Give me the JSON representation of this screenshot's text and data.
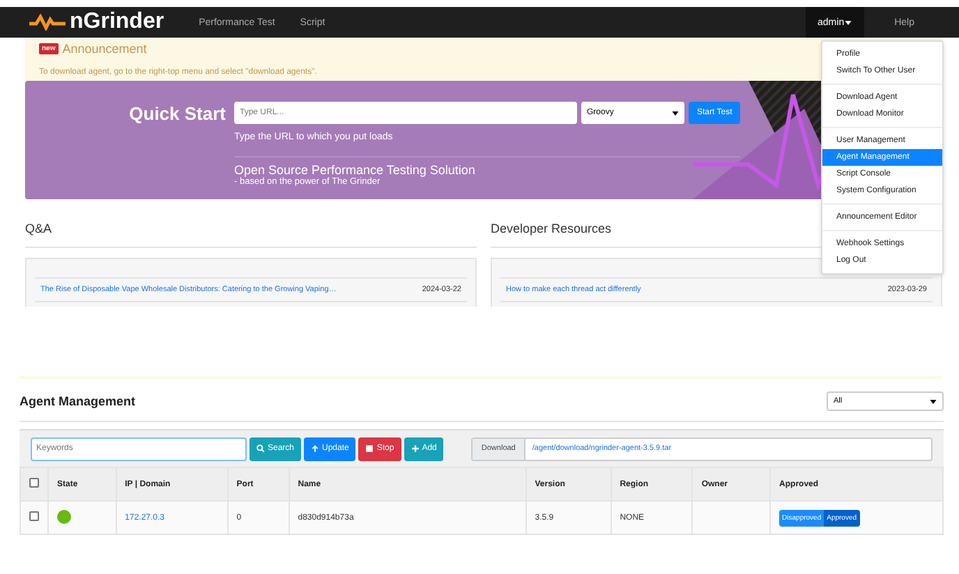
{
  "navbar": {
    "logo": "nGrinder",
    "links": [
      "Performance Test",
      "Script"
    ],
    "user": "admin",
    "help": "Help"
  },
  "announcement": {
    "badge": "new",
    "title": "Announcement",
    "text": "To download agent, go to the right-top menu and select \"download agents\"."
  },
  "quick_start": {
    "title": "Quick Start",
    "placeholder": "Type URL...",
    "language": "Groovy",
    "button": "Start Test",
    "hint": "Type the URL to which you put loads",
    "tagline": "Open Source Performance Testing Solution",
    "subline": "- based on the power of The Grinder"
  },
  "panels": [
    {
      "title": "Q&A",
      "items": [
        {
          "title": "The Rise of Disposable Vape Wholesale Distributors: Catering to the Growing Vaping…",
          "date": "2024-03-22"
        }
      ]
    },
    {
      "title": "Developer Resources",
      "items": [
        {
          "title": "How to make each thread act differently",
          "date": "2023-03-29"
        }
      ]
    }
  ],
  "agents": {
    "title": "Agent Management",
    "filter": "All",
    "search_placeholder": "Keywords",
    "buttons": [
      {
        "kind": "search",
        "label": "Search"
      },
      {
        "kind": "update",
        "label": "Update"
      },
      {
        "kind": "stop",
        "label": "Stop"
      },
      {
        "kind": "add",
        "label": "Add"
      }
    ],
    "download_label": "Download",
    "download_link": "/agent/download/ngrinder-agent-3.5.9.tar",
    "header_checked": false,
    "columns": [
      "State",
      "IP | Domain",
      "Port",
      "Name",
      "Version",
      "Region",
      "Owner",
      "Approved"
    ],
    "rows": [
      {
        "checked": false,
        "color": "#66bb11",
        "ip": "172.27.0.3",
        "port": "0",
        "name": "d830d914b73a",
        "version": "3.5.9",
        "region": "NONE",
        "owner": "",
        "approval": [
          {
            "label": "Disapproved",
            "selected": false
          },
          {
            "label": "Approved",
            "selected": true
          }
        ]
      }
    ]
  },
  "menu": {
    "groups": [
      [
        {
          "label": "Profile",
          "selected": false
        },
        {
          "label": "Switch To Other User",
          "selected": false
        }
      ],
      [
        {
          "label": "Download Agent",
          "selected": false
        },
        {
          "label": "Download Monitor",
          "selected": false
        }
      ],
      [
        {
          "label": "User Management",
          "selected": false
        },
        {
          "label": "Agent Management",
          "selected": true
        },
        {
          "label": "Script Console",
          "selected": false
        },
        {
          "label": "System Configuration",
          "selected": false
        }
      ],
      [
        {
          "label": "Announcement Editor",
          "selected": false
        }
      ],
      [
        {
          "label": "Webhook Settings",
          "selected": false
        },
        {
          "label": "Log Out",
          "selected": false
        }
      ]
    ]
  }
}
